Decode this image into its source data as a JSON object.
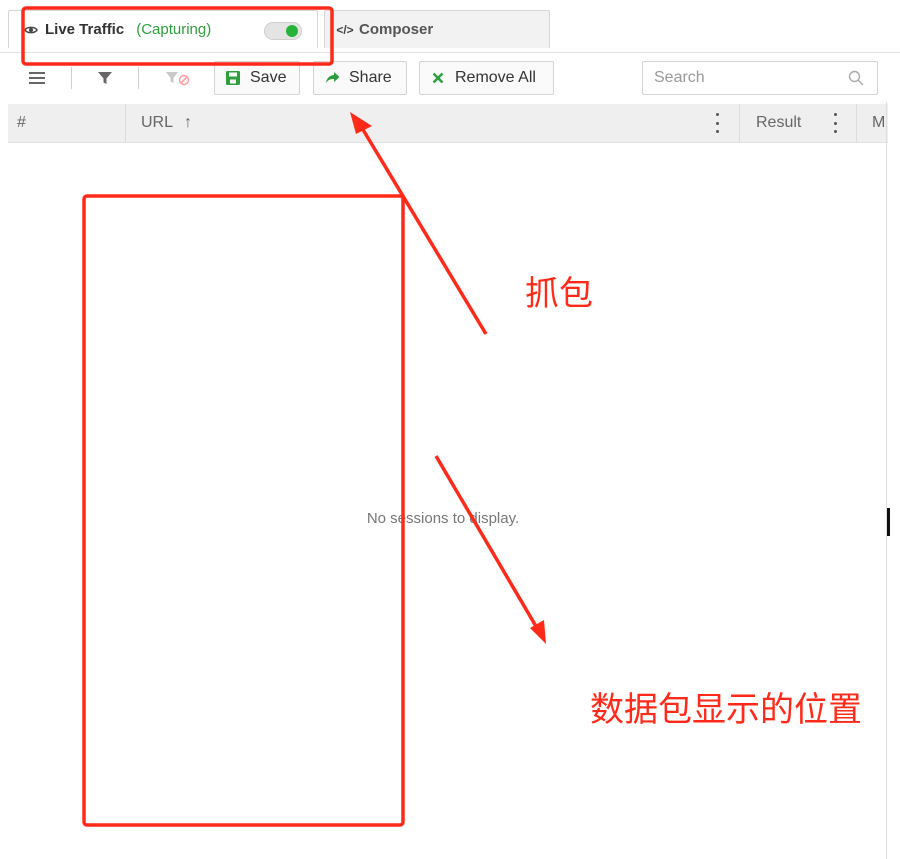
{
  "tabs": {
    "live_traffic": {
      "label": "Live Traffic",
      "status": "(Capturing)",
      "capturing": true
    },
    "composer": {
      "label": "Composer"
    }
  },
  "toolbar": {
    "save_label": "Save",
    "share_label": "Share",
    "remove_all_label": "Remove All",
    "search_placeholder": "Search"
  },
  "table": {
    "columns": [
      "#",
      "URL",
      "Result",
      "M"
    ],
    "sort_indicator": "↑",
    "empty_message": "No sessions to display."
  },
  "annotations": {
    "capture_label": "抓包",
    "packet_area_label": "数据包显示的位置"
  },
  "colors": {
    "capturing_green": "#2e9e3e",
    "toggle_on": "#27b33a",
    "annotation_red": "#ff2a1a",
    "save_icon": "#2e9e3e",
    "remove_icon": "#2e9e3e"
  },
  "icons": {
    "live_traffic": "eye-icon",
    "composer": "code-icon",
    "menu": "hamburger-icon",
    "filter": "filter-icon",
    "clear_filter": "filter-off-icon",
    "save": "floppy-disk-icon",
    "share": "share-arrow-icon",
    "remove_all": "x-icon",
    "search": "magnifier-icon"
  }
}
